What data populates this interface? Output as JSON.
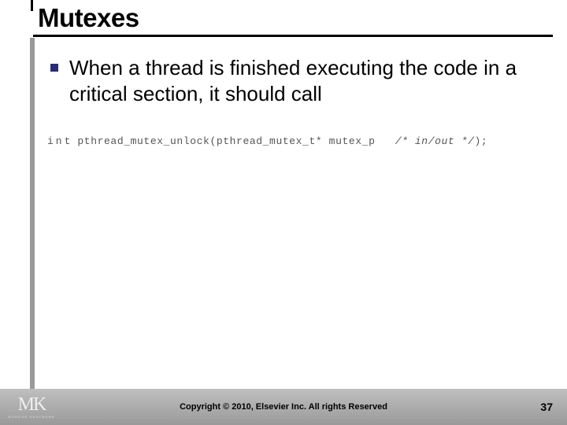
{
  "title": "Mutexes",
  "bullet_text": "When a thread is finished executing the code in a critical section, it should call",
  "code": {
    "kw": "int",
    "fn": "pthread_mutex_unlock",
    "sig_open": "(",
    "argtype": "pthread_mutex_t*",
    "argname": "mutex_p",
    "comment": "/*  in/out  */",
    "sig_close": ");"
  },
  "logo": {
    "mk": "MK",
    "sub": "MORGAN KAUFMANN"
  },
  "copyright": "Copyright © 2010, Elsevier Inc. All rights Reserved",
  "page": "37"
}
